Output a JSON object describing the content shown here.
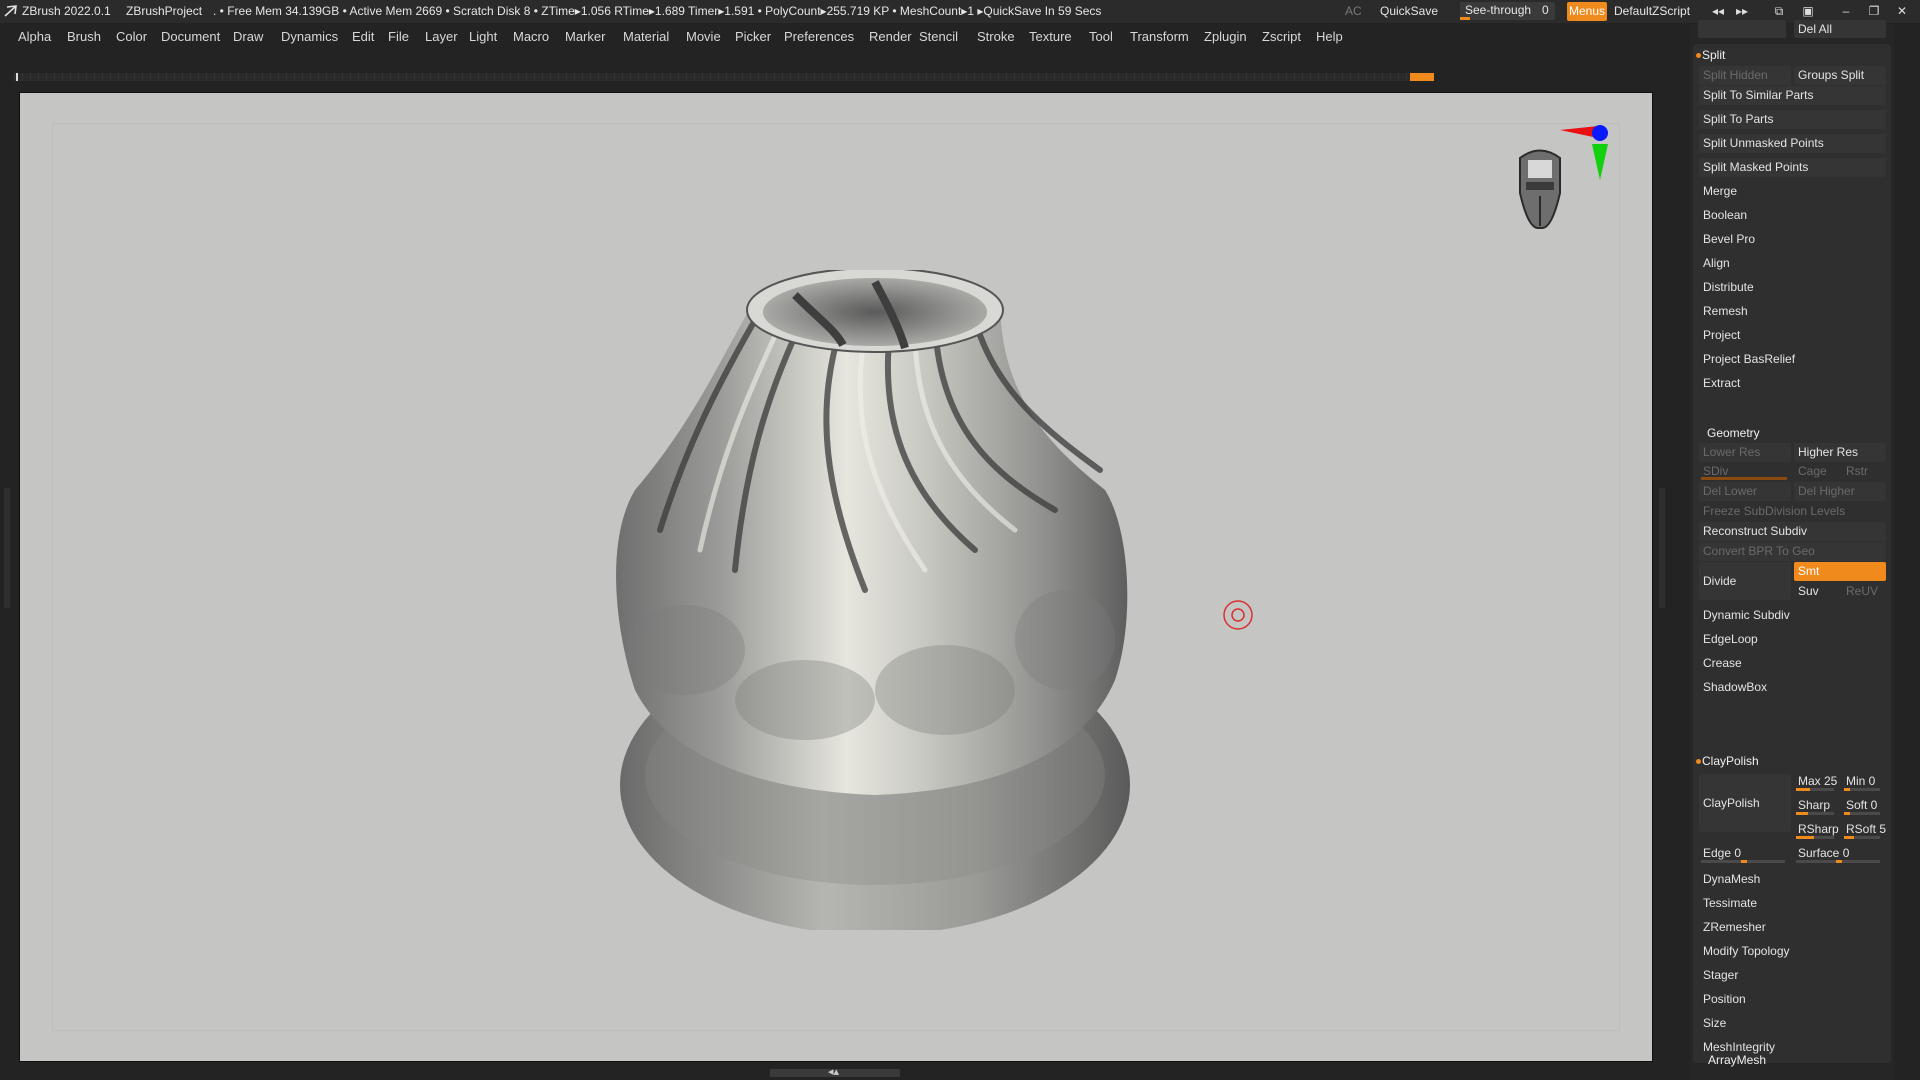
{
  "titlebar": {
    "app": "ZBrush 2022.0.1",
    "project": "ZBrushProject",
    "status": ". • Free Mem 34.139GB • Active Mem 2669 • Scratch Disk 8 •  ZTime▸1.056 RTime▸1.689 Timer▸1.591 • PolyCount▸255.719 KP  • MeshCount▸1  ▸QuickSave In 59 Secs",
    "ac": "AC",
    "quicksave": "QuickSave",
    "seethrough_label": "See-through",
    "seethrough_value": "0",
    "seethrough_level": 0.1,
    "menus": "Menus",
    "script": "DefaultZScript"
  },
  "colors": {
    "accent": "#f08a1c",
    "viewport_bg": "#c5c5c3",
    "panel_bg": "#262626"
  },
  "menubar": [
    "Alpha",
    "Brush",
    "Color",
    "Document",
    "Draw",
    "Dynamics",
    "Edit",
    "File",
    "Layer",
    "Light",
    "Macro",
    "Marker",
    "Material",
    "Movie",
    "Picker",
    "Preferences",
    "Render",
    "Stencil",
    "Stroke",
    "Texture",
    "Tool",
    "Transform",
    "Zplugin",
    "Zscript",
    "Help"
  ],
  "panel": {
    "del_all": "Del All",
    "split": {
      "title": "Split",
      "split_hidden": "Split Hidden",
      "groups_split": "Groups Split",
      "items": [
        "Split To Similar Parts",
        "Split To Parts",
        "Split Unmasked Points",
        "Split Masked Points"
      ]
    },
    "subtool_items": [
      "Merge",
      "Boolean",
      "Bevel Pro",
      "Align",
      "Distribute",
      "Remesh",
      "Project",
      "Project BasRelief",
      "Extract"
    ],
    "geometry": {
      "title": "Geometry",
      "lower_res": "Lower Res",
      "higher_res": "Higher Res",
      "sdiv": "SDiv",
      "cage": "Cage",
      "rstr": "Rstr",
      "del_lower": "Del Lower",
      "del_higher": "Del Higher",
      "freeze": "Freeze SubDivision Levels",
      "reconstruct": "Reconstruct Subdiv",
      "convert_bpr": "Convert BPR To Geo",
      "divide": "Divide",
      "smt": "Smt",
      "suv": "Suv",
      "reuv": "ReUV",
      "items": [
        "Dynamic Subdiv",
        "EdgeLoop",
        "Crease",
        "ShadowBox"
      ]
    },
    "claypolish": {
      "title": "ClayPolish",
      "button": "ClayPolish",
      "max": "Max 25",
      "min": "Min 0",
      "sharp": "Sharp",
      "soft": "Soft 0",
      "rsharp": "RSharp",
      "rsoft": "RSoft 5",
      "edge": "Edge 0",
      "surface": "Surface 0"
    },
    "items_after": [
      "DynaMesh",
      "Tessimate",
      "ZRemesher",
      "Modify Topology",
      "Stager",
      "Position",
      "Size",
      "MeshIntegrity"
    ],
    "arraymesh": "ArrayMesh"
  }
}
